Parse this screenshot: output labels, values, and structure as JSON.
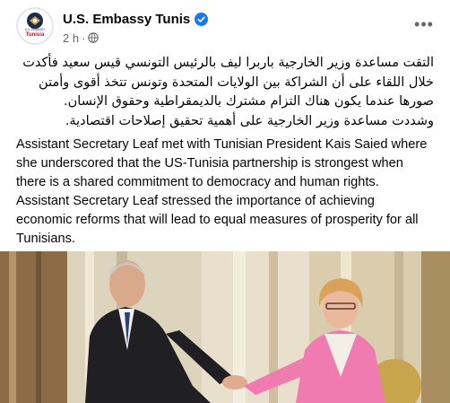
{
  "post": {
    "page_name": "U.S. Embassy Tunis",
    "time": "2 h",
    "separator": "·",
    "avatar_label": "Tunisia",
    "avatar_top_text": "U.S. EMBASSY",
    "more_icon": "ellipsis-icon",
    "verified_icon": "verified-badge-icon",
    "privacy_icon": "globe-icon",
    "arabic_text": "التقت مساعدة وزير الخارجية باربرا ليف بالرئيس التونسي قيس سعيد فأكدت\nخلال اللقاء على أن الشراكة بين الولايات المتحدة وتونس تتخذ أقوى وأمتن\nصورها عندما يكون هناك التزام مشترك بالديمقراطية وحقوق الإنسان.\nوشددت مساعدة وزير الخارجية على أهمية تحقيق إصلاحات اقتصادية.",
    "english_text": "Assistant Secretary Leaf met with Tunisian President Kais Saied where\nshe underscored that the US-Tunisia partnership is strongest when\nthere is a shared commitment to democracy and human rights.\nAssistant Secretary Leaf stressed the importance of achieving\neconomic reforms that will lead to equal measures of prosperity for all\nTunisians."
  },
  "colors": {
    "verified_blue": "#1877f2",
    "secondary_text": "#65676b",
    "curtain": "#d8cfb8",
    "suit": "#1f1f24",
    "pink_jacket": "#f07bb0"
  }
}
